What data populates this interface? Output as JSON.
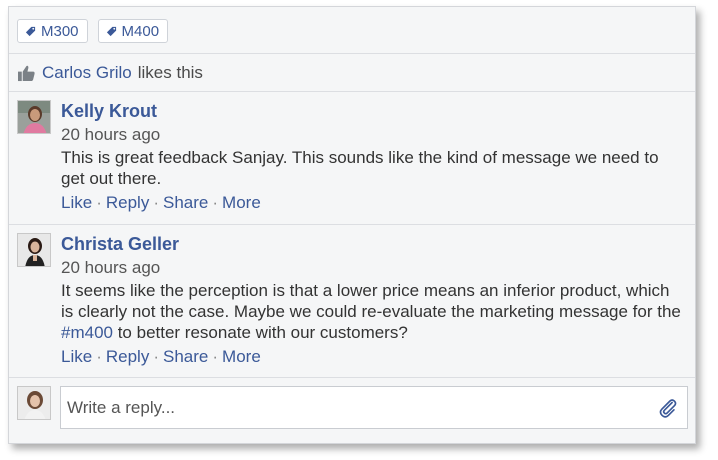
{
  "tags": [
    {
      "label": "M300"
    },
    {
      "label": "M400"
    }
  ],
  "likes": {
    "liker": "Carlos Grilo",
    "suffix": "likes this"
  },
  "comments": [
    {
      "author": "Kelly Krout",
      "time": "20 hours ago",
      "text_before": "This is great feedback Sanjay. This sounds like the kind of message we need to get out there.",
      "hashtag": "",
      "text_after": "",
      "actions": [
        "Like",
        "Reply",
        "Share",
        "More"
      ]
    },
    {
      "author": "Christa Geller",
      "time": "20 hours ago",
      "text_before": "It seems like the perception is that a lower price means an inferior product, which is clearly not the case. Maybe we could re-evaluate the marketing message for the ",
      "hashtag": "#m400",
      "text_after": " to better resonate with our customers?",
      "actions": [
        "Like",
        "Reply",
        "Share",
        "More"
      ]
    }
  ],
  "reply": {
    "placeholder": "Write a reply...",
    "attach_icon": "paperclip-icon"
  },
  "colors": {
    "link": "#3b5998",
    "card_bg": "#f5f6f7",
    "border": "#d4d6da"
  }
}
